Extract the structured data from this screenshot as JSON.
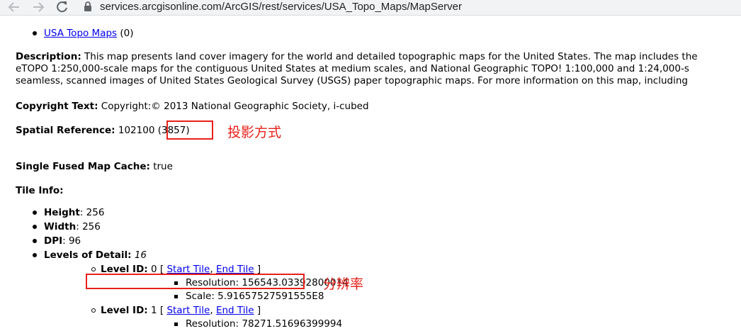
{
  "browser": {
    "url": "services.arcgisonline.com/ArcGIS/rest/services/USA_Topo_Maps/MapServer"
  },
  "page": {
    "layer": {
      "link": "USA Topo Maps",
      "count": "(0)"
    },
    "description": {
      "label": "Description:",
      "line1": "This map presents land cover imagery for the world and detailed topographic maps for the United States. The map includes the",
      "line2": "eTOPO 1:250,000-scale maps for the contiguous United States at medium scales, and National Geographic TOPO! 1:100,000 and 1:24,000-s",
      "line3": "seamless, scanned images of United States Geological Survey (USGS) paper topographic maps. For more information on this map, including"
    },
    "copyright": {
      "label": "Copyright Text:",
      "value": "Copyright:© 2013 National Geographic Society, i-cubed"
    },
    "spatial_reference": {
      "label": "Spatial Reference:",
      "value": "102100",
      "latest": "(3857)"
    },
    "single_fused": {
      "label": "Single Fused Map Cache:",
      "value": "true"
    },
    "tile_info": {
      "label": "Tile Info:",
      "height": {
        "label": "Height",
        "value": ": 256"
      },
      "width": {
        "label": "Width",
        "value": ": 256"
      },
      "dpi": {
        "label": "DPI",
        "value": ": 96"
      },
      "lods": {
        "label": "Levels of Detail:",
        "value": "16"
      },
      "levels": [
        {
          "label": "Level ID:",
          "id": "0",
          "open": "[",
          "start": "Start Tile",
          "sep": ",",
          "end": "End Tile",
          "close": "]",
          "resolution": "Resolution: 156543.03392800014",
          "scale": "Scale: 5.91657527591555E8"
        },
        {
          "label": "Level ID:",
          "id": "1",
          "open": "[",
          "start": "Start Tile",
          "sep": ",",
          "end": "End Tile",
          "close": "]",
          "resolution": "Resolution: 78271.51696399994"
        }
      ]
    }
  },
  "annotations": {
    "projection_note": "投影方式",
    "resolution_note": "分辨率",
    "color": "#e8201a"
  }
}
